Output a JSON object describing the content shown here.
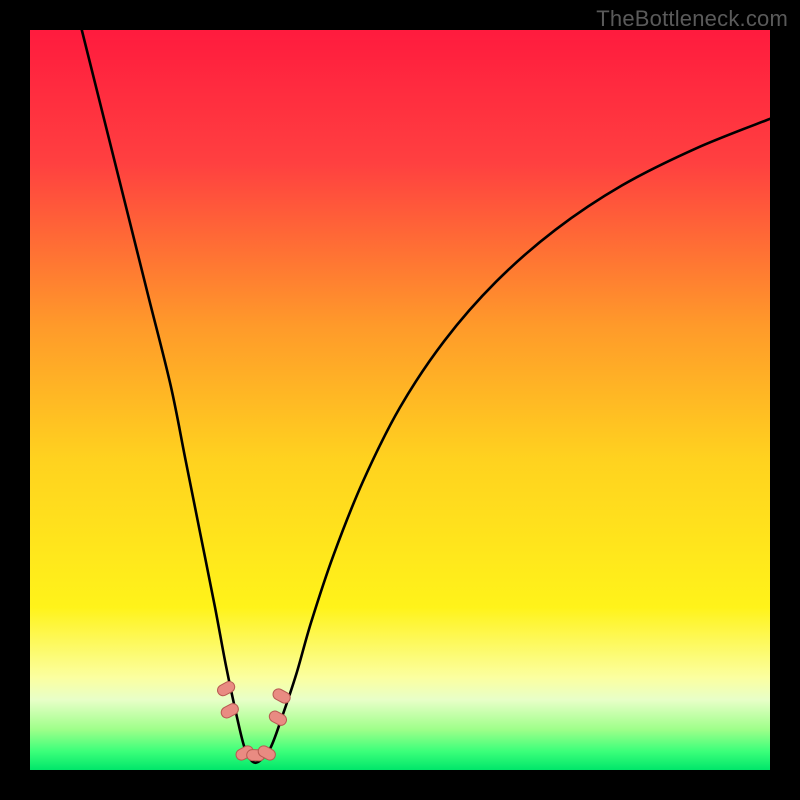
{
  "watermark": "TheBottleneck.com",
  "chart_data": {
    "type": "line",
    "title": "",
    "xlabel": "",
    "ylabel": "",
    "xlim": [
      0,
      100
    ],
    "ylim": [
      0,
      100
    ],
    "series": [
      {
        "name": "bottleneck-curve",
        "x": [
          7,
          10,
          13,
          16,
          19,
          21,
          23,
          25,
          26.5,
          28,
          29,
          30,
          31,
          32.5,
          34,
          36,
          38,
          41,
          45,
          50,
          56,
          63,
          71,
          80,
          90,
          100
        ],
        "values": [
          100,
          88,
          76,
          64,
          52,
          42,
          32,
          22,
          14,
          7,
          3,
          1.2,
          1.2,
          3,
          7,
          13,
          20,
          29,
          39,
          49,
          58,
          66,
          73,
          79,
          84,
          88
        ]
      }
    ],
    "markers": [
      {
        "name": "left-marker-top",
        "x": 26.5,
        "y": 11
      },
      {
        "name": "left-marker-bottom",
        "x": 27.0,
        "y": 8
      },
      {
        "name": "right-marker-top",
        "x": 34.0,
        "y": 10
      },
      {
        "name": "right-marker-bottom",
        "x": 33.5,
        "y": 7
      },
      {
        "name": "bottom-marker-left",
        "x": 29.0,
        "y": 2.3
      },
      {
        "name": "bottom-marker-mid",
        "x": 30.5,
        "y": 2.0
      },
      {
        "name": "bottom-marker-right",
        "x": 32.0,
        "y": 2.3
      }
    ],
    "gradient_stops": [
      {
        "offset": 0,
        "color": "#ff1b3e"
      },
      {
        "offset": 0.18,
        "color": "#ff4040"
      },
      {
        "offset": 0.4,
        "color": "#ff9a2a"
      },
      {
        "offset": 0.58,
        "color": "#ffd21f"
      },
      {
        "offset": 0.78,
        "color": "#fff31a"
      },
      {
        "offset": 0.875,
        "color": "#fbffa0"
      },
      {
        "offset": 0.905,
        "color": "#e8ffc8"
      },
      {
        "offset": 0.945,
        "color": "#9fff8a"
      },
      {
        "offset": 0.975,
        "color": "#3bff7a"
      },
      {
        "offset": 1.0,
        "color": "#00e66a"
      }
    ]
  }
}
